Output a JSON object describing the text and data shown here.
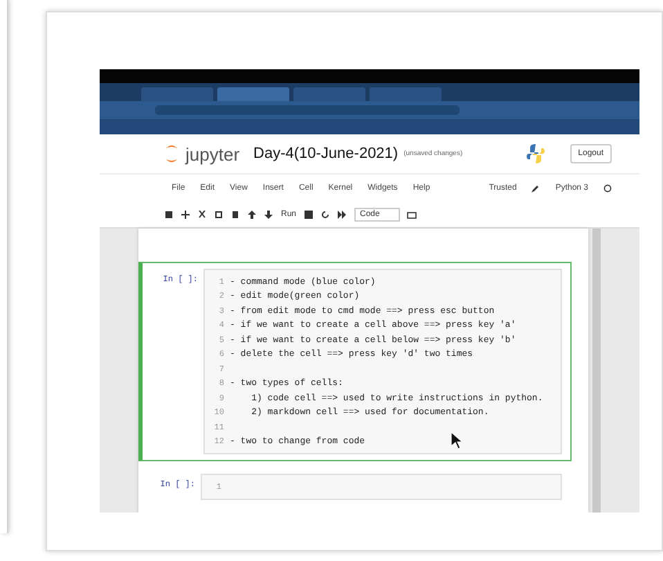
{
  "browser": {
    "tabs": [
      {
        "selected": false
      },
      {
        "selected": true
      },
      {
        "selected": false
      },
      {
        "selected": false
      }
    ]
  },
  "notebook": {
    "logo_text": "jupyter",
    "title": "Day-4(10-June-2021)",
    "save_status": "(unsaved changes)",
    "logout": "Logout",
    "menu": [
      "File",
      "Edit",
      "View",
      "Insert",
      "Cell",
      "Kernel",
      "Widgets",
      "Help"
    ],
    "trusted": "Trusted",
    "kernel": "Python 3",
    "toolbar": {
      "run": "Run",
      "cell_type": "Code"
    },
    "cells": [
      {
        "prompt": "In [ ]:",
        "selected": true,
        "lines": [
          {
            "number": "1",
            "text": "- command mode (blue color)"
          },
          {
            "number": "2",
            "text": "- edit mode(green color)"
          },
          {
            "number": "3",
            "text": "- from edit mode to cmd mode ==> press esc button"
          },
          {
            "number": "4",
            "text": "- if we want to create a cell above ==> press key 'a'"
          },
          {
            "number": "5",
            "text": "- if we want to create a cell below ==> press key 'b'"
          },
          {
            "number": "6",
            "text": "- delete the cell ==> press key 'd' two times"
          },
          {
            "number": "7"
          },
          {
            "number": "8",
            "text": "- two types of cells:"
          },
          {
            "number": "9",
            "text": "    1) code cell ==> used to write instructions in python."
          },
          {
            "number": "10",
            "text": "    2) markdown cell ==> used for documentation."
          },
          {
            "number": "11"
          },
          {
            "number": "12",
            "text": "- two to change from code"
          }
        ]
      },
      {
        "prompt": "In [ ]:",
        "selected": false,
        "lines": [
          {
            "number": "1"
          }
        ]
      }
    ]
  }
}
